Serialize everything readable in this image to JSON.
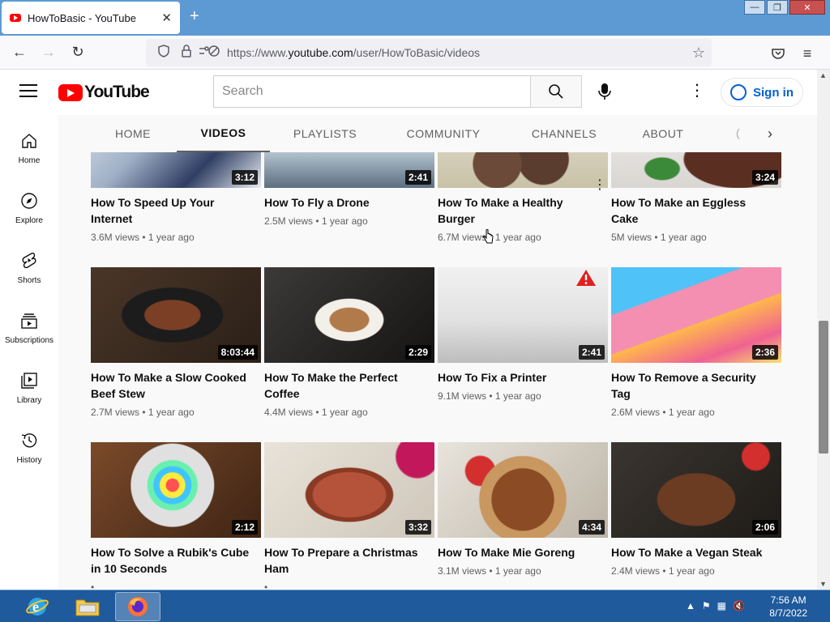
{
  "browser": {
    "tab_title": "HowToBasic - YouTube",
    "tab_close": "✕",
    "new_tab": "+",
    "url_prefix": "https://www.",
    "url_domain": "youtube.com",
    "url_path": "/user/HowToBasic/videos",
    "window_buttons": [
      "—",
      "❐",
      "✕"
    ]
  },
  "youtube": {
    "logo_text": "YouTube",
    "search_placeholder": "Search",
    "sign_in": "Sign in",
    "guide": [
      {
        "label": "Home",
        "icon": "home-icon"
      },
      {
        "label": "Explore",
        "icon": "compass-icon"
      },
      {
        "label": "Shorts",
        "icon": "shorts-icon"
      },
      {
        "label": "Subscriptions",
        "icon": "subscriptions-icon"
      },
      {
        "label": "Library",
        "icon": "library-icon"
      },
      {
        "label": "History",
        "icon": "history-icon"
      }
    ],
    "channel_tabs": [
      "HOME",
      "VIDEOS",
      "PLAYLISTS",
      "COMMUNITY",
      "CHANNELS",
      "ABOUT"
    ],
    "active_tab": "VIDEOS",
    "videos_row1": [
      {
        "title": "How To Speed Up Your Internet",
        "duration": "3:12",
        "views": "3.6M views",
        "age": "1 year ago"
      },
      {
        "title": "How To Fly a Drone",
        "duration": "2:41",
        "views": "2.5M views",
        "age": "1 year ago"
      },
      {
        "title": "How To Make a Healthy Burger",
        "duration": "",
        "views": "6.7M views",
        "age": "1 year ago"
      },
      {
        "title": "How To Make an Eggless Cake",
        "duration": "3:24",
        "views": "5M views",
        "age": "1 year ago"
      }
    ],
    "videos_row2": [
      {
        "title": "How To Make a Slow Cooked Beef Stew",
        "duration": "8:03:44",
        "views": "2.7M views",
        "age": "1 year ago"
      },
      {
        "title": "How To Make the Perfect Coffee",
        "duration": "2:29",
        "views": "4.4M views",
        "age": "1 year ago"
      },
      {
        "title": "How To Fix a Printer",
        "duration": "2:41",
        "views": "9.1M views",
        "age": "1 year ago"
      },
      {
        "title": "How To Remove a Security Tag",
        "duration": "2:36",
        "views": "2.6M views",
        "age": "1 year ago"
      }
    ],
    "videos_row3": [
      {
        "title": "How To Solve a Rubik's Cube in 10 Seconds",
        "duration": "2:12",
        "views": "",
        "age": ""
      },
      {
        "title": "How To Prepare a Christmas Ham",
        "duration": "3:32",
        "views": "",
        "age": ""
      },
      {
        "title": "How To Make Mie Goreng",
        "duration": "4:34",
        "views": "3.1M views",
        "age": "1 year ago"
      },
      {
        "title": "How To Make a Vegan Steak",
        "duration": "2:06",
        "views": "2.4M views",
        "age": "1 year ago"
      }
    ],
    "meta_separator": "•"
  },
  "taskbar": {
    "time": "7:56 AM",
    "date": "8/7/2022"
  }
}
